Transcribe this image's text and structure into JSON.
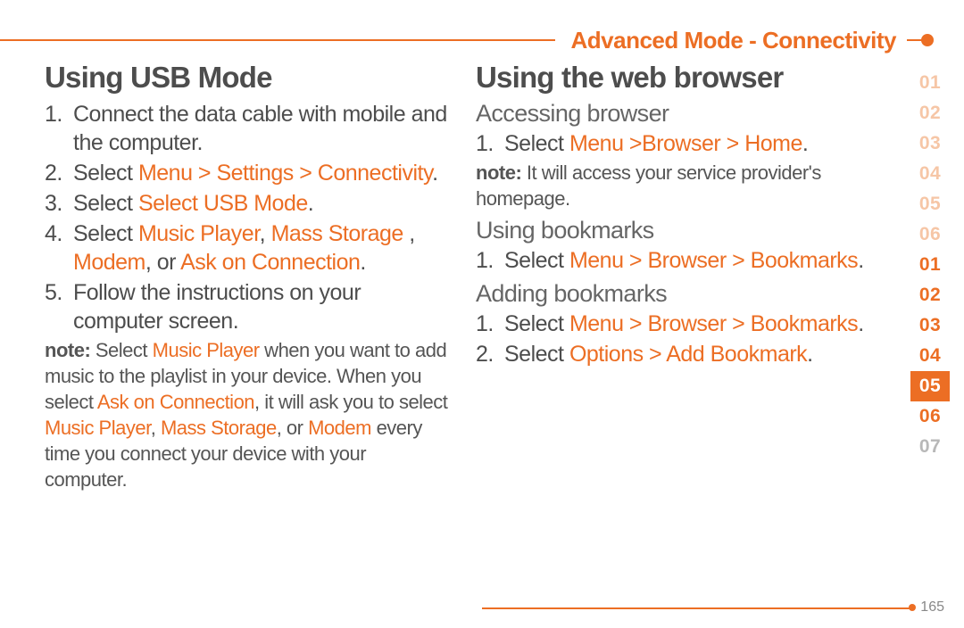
{
  "header": {
    "breadcrumb": "Advanced Mode - Connectivity"
  },
  "left": {
    "title": "Using USB Mode",
    "steps": [
      {
        "n": "1.",
        "pre": " Connect the data cable with mobile and the computer."
      },
      {
        "n": "2.",
        "pre": "Select ",
        "hl": "Menu > Settings > Connectivity",
        "post": "."
      },
      {
        "n": "3.",
        "pre": "Select ",
        "hl": "Select USB Mode",
        "post": "."
      },
      {
        "n": "4.",
        "pre": "Select ",
        "hl1": "Music Player",
        "mid1": ", ",
        "hl2": "Mass Storage ",
        "mid2": ", ",
        "hl3": "Modem",
        "mid3": ", or ",
        "hl4": "Ask on Connection",
        "post": "."
      },
      {
        "n": "5.",
        "pre": "Follow the instructions on your computer screen."
      }
    ],
    "note": {
      "label": "note:",
      "t1": " Select ",
      "h1": "Music Player",
      "t2": " when you want to add music to the playlist in your device. When you select ",
      "h2": "Ask on Connection",
      "t3": ", it will ask you to select ",
      "h3": "Music Player",
      "t4": ", ",
      "h4": "Mass Storage",
      "t5": ", or ",
      "h5": "Modem",
      "t6": " every time you connect your device with your computer."
    }
  },
  "right": {
    "title": "Using the web browser",
    "sec1": {
      "heading": "Accessing browser",
      "step": {
        "n": "1.",
        "pre": " Select ",
        "hl": "Menu >Browser > Home",
        "post": "."
      },
      "note": {
        "label": "note:",
        "text": " It will access your service provider's homepage."
      }
    },
    "sec2": {
      "heading": "Using bookmarks",
      "step": {
        "n": "1.",
        "pre": " Select ",
        "hl": "Menu > Browser > Bookmarks",
        "post": "."
      }
    },
    "sec3": {
      "heading": "Adding bookmarks",
      "step1": {
        "n": "1.",
        "pre": " Select ",
        "hl": "Menu > Browser > Bookmarks",
        "post": "."
      },
      "step2": {
        "n": "2.",
        "pre": "Select ",
        "hl": "Options > Add Bookmark",
        "post": "."
      }
    }
  },
  "sidebar": {
    "items": [
      {
        "v": "01",
        "cls": "light"
      },
      {
        "v": "02",
        "cls": "light"
      },
      {
        "v": "03",
        "cls": "light"
      },
      {
        "v": "04",
        "cls": "light"
      },
      {
        "v": "05",
        "cls": "light"
      },
      {
        "v": "06",
        "cls": "light"
      },
      {
        "v": "01",
        "cls": "dark"
      },
      {
        "v": "02",
        "cls": "dark"
      },
      {
        "v": "03",
        "cls": "dark"
      },
      {
        "v": "04",
        "cls": "dark"
      },
      {
        "v": "05",
        "cls": "active"
      },
      {
        "v": "06",
        "cls": "dark"
      },
      {
        "v": "07",
        "cls": "grey"
      }
    ]
  },
  "footer": {
    "page": "165"
  }
}
